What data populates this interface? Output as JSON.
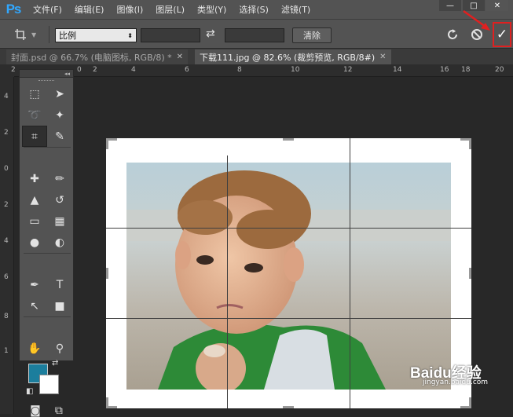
{
  "app": {
    "logo": "Ps",
    "menu": [
      "文件(F)",
      "编辑(E)",
      "图像(I)",
      "图层(L)",
      "类型(Y)",
      "选择(S)",
      "滤镜(T)"
    ],
    "window_controls": {
      "minimize": "—",
      "maximize": "□",
      "close": "✕"
    }
  },
  "options_bar": {
    "tool_icon": "crop-icon",
    "ratio_label": "比例",
    "width_value": "",
    "height_value": "",
    "clear_label": "清除",
    "reset_icon": "reset-icon",
    "cancel_icon": "cancel-icon",
    "commit_icon": "checkmark-icon",
    "commit_symbol": "✓",
    "highlight_color": "#e02020"
  },
  "tabs": [
    {
      "label": "封面.psd @ 66.7% (电脑图标, RGB/8) *",
      "close": "✕",
      "active": false
    },
    {
      "label": "下载111.jpg @ 82.6% (裁剪预览, RGB/8#)",
      "close": "✕",
      "active": true
    }
  ],
  "ruler": {
    "h_ticks": [
      "2",
      "0",
      "2",
      "4",
      "6",
      "8",
      "10",
      "12",
      "14",
      "16",
      "18",
      "20"
    ],
    "v_ticks": [
      "4",
      "2",
      "0",
      "2",
      "4",
      "6",
      "8",
      "1"
    ]
  },
  "toolbox": {
    "collapse": "◂◂",
    "close": "✕",
    "tools": [
      {
        "name": "marquee-icon",
        "glyph": "⬚"
      },
      {
        "name": "move-icon",
        "glyph": "➤"
      },
      {
        "name": "lasso-icon",
        "glyph": "➰"
      },
      {
        "name": "magic-wand-icon",
        "glyph": "✦"
      },
      {
        "name": "crop-tool-icon",
        "glyph": "⌗"
      },
      {
        "name": "eyedropper-icon",
        "glyph": "✎"
      },
      {
        "name": "healing-brush-icon",
        "glyph": "✚"
      },
      {
        "name": "brush-icon",
        "glyph": "✏"
      },
      {
        "name": "stamp-icon",
        "glyph": "▲"
      },
      {
        "name": "history-brush-icon",
        "glyph": "↺"
      },
      {
        "name": "eraser-icon",
        "glyph": "▭"
      },
      {
        "name": "gradient-icon",
        "glyph": "▦"
      },
      {
        "name": "blur-icon",
        "glyph": "●"
      },
      {
        "name": "dodge-icon",
        "glyph": "◐"
      },
      {
        "name": "pen-icon",
        "glyph": "✒"
      },
      {
        "name": "type-icon",
        "glyph": "T"
      },
      {
        "name": "path-select-icon",
        "glyph": "↖"
      },
      {
        "name": "shape-icon",
        "glyph": "■"
      },
      {
        "name": "hand-icon",
        "glyph": "✋"
      },
      {
        "name": "zoom-icon",
        "glyph": "⚲"
      }
    ],
    "foreground_color": "#1c7e9d",
    "background_color": "#ffffff",
    "swap_glyph": "⇄",
    "default_glyph": "◧",
    "quick_mask_glyph": "◙",
    "screen_mode_glyph": "⧉"
  },
  "watermark": {
    "text": "Baidu经验",
    "sub": "jingyan.baidu.com"
  }
}
